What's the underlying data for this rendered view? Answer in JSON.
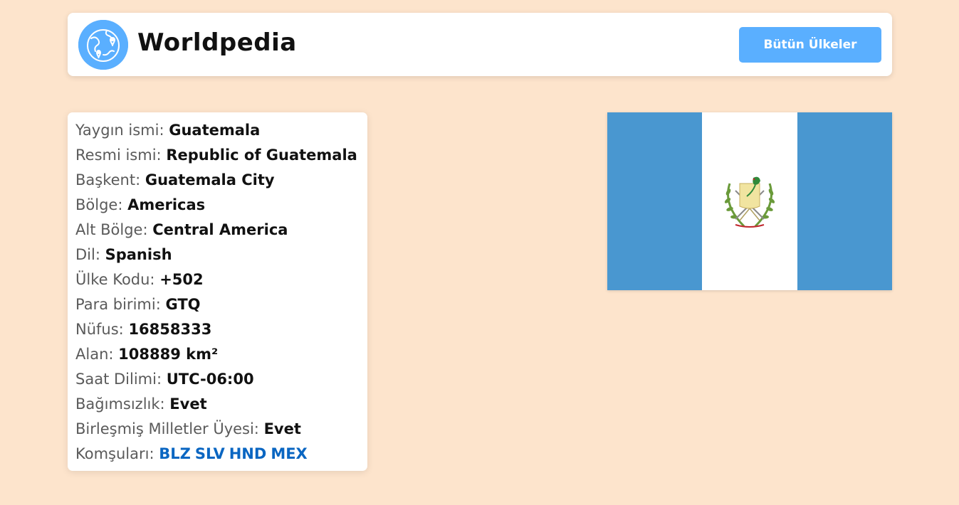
{
  "header": {
    "brand": "Worldpedia",
    "all_countries_label": "Bütün Ülkeler",
    "logo_icon": "globe-map-pin-icon",
    "accent_color": "#5aafff"
  },
  "country": {
    "rows": [
      {
        "label": "Yaygın ismi:",
        "value": "Guatemala"
      },
      {
        "label": "Resmi ismi:",
        "value": "Republic of Guatemala"
      },
      {
        "label": "Başkent:",
        "value": "Guatemala City"
      },
      {
        "label": "Bölge:",
        "value": "Americas"
      },
      {
        "label": "Alt Bölge:",
        "value": "Central America"
      },
      {
        "label": "Dil:",
        "value": "Spanish"
      },
      {
        "label": "Ülke Kodu:",
        "value": "+502"
      },
      {
        "label": "Para birimi:",
        "value": "GTQ"
      },
      {
        "label": "Nüfus:",
        "value": "16858333"
      },
      {
        "label": "Alan:",
        "value": "108889 km²"
      },
      {
        "label": "Saat Dilimi:",
        "value": "UTC-06:00"
      },
      {
        "label": "Bağımsızlık:",
        "value": "Evet"
      },
      {
        "label": "Birleşmiş Milletler Üyesi:",
        "value": "Evet"
      }
    ],
    "neighbors_label": "Komşuları:",
    "neighbors": [
      "BLZ",
      "SLV",
      "HND",
      "MEX"
    ],
    "neighbor_color": "#0a66c2",
    "flag": {
      "name": "guatemala-flag",
      "stripe_color": "#4997d0",
      "center_color": "#ffffff"
    }
  }
}
